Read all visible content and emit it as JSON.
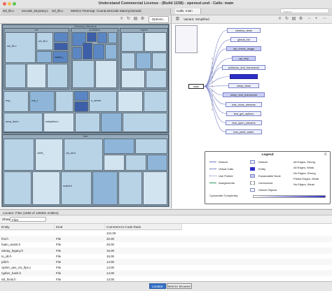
{
  "window": {
    "title": "Understand Commercial License - (Build 1158) - openssl.und - Calls: main"
  },
  "tabs": [
    {
      "label": "ssl_lib.c"
    },
    {
      "label": "encode_key2any.c"
    },
    {
      "label": "ssl_lib.c"
    },
    {
      "label": "Metrics Treemap: CountLineCode MaxCyclomatic"
    },
    {
      "label": "Calls: main"
    }
  ],
  "search": {
    "placeholder": "Search"
  },
  "treemap_panel": {
    "options_label": "Options...",
    "group_labels": {
      "top": "Directory Structure",
      "ssl": "ssl",
      "crypto": "crypto",
      "providers": "providers",
      "test": "test",
      "apps": "apps"
    },
    "block_labels": {
      "ssl_lib": "ssl_lib.c",
      "s3_lib": "s3_lib.c",
      "statem": "statem_",
      "sslapitest": "sslapitest.c",
      "acvptest": "acvp_test.c",
      "x509": "x509_",
      "cls_dir": "cls_dir.h",
      "evp": "evp_",
      "evpt": "evp_t",
      "ssl_sw": "s_server",
      "sct": "sctest.h"
    }
  },
  "calls_panel": {
    "variant_label": "Variant: Simplified",
    "main_node": "main",
    "edge_label": "1",
    "callees": [
      "cleanup_tests",
      "global_init",
      "opt_check_usage",
      "opt_help",
      "pulldown_test_framework",
      "",
      "setup_tests",
      "setup_test_framework",
      "test_close_streams",
      "test_get_options",
      "test_open_streams",
      "test_printf_stderr"
    ],
    "legend": {
      "title": "Legend",
      "col1": [
        "Default",
        "Virtual Calls",
        "Use Pointer",
        "Assignments"
      ],
      "col2": [
        "Default",
        "Entity",
        "Expandable Node",
        "Unresolved",
        "Global Objects"
      ],
      "col3": [
        "All Edges, Strong",
        "All Edges, Weak",
        "No Edges, Strong",
        "Partial Edges, Weak",
        "No Edges, Weak"
      ],
      "gradient_label": "Cyclomatic Complexity"
    }
  },
  "locator": {
    "header": "Locator: Files (1980 of 138381 entities)",
    "show_label": "Show:",
    "show_value": "Files",
    "columns": [
      "Entity",
      "Kind",
      "Comment to Code Ratio"
    ],
    "rows": [
      {
        "entity": "",
        "kind": "",
        "ratio": "101.00"
      },
      {
        "entity": "fmt.h",
        "kind": "File",
        "ratio": "32.00"
      },
      {
        "entity": "haan_assist.h",
        "kind": "File",
        "ratio": "26.00"
      },
      {
        "entity": "ssleay_legacy.h",
        "kind": "File",
        "ratio": "16.00"
      },
      {
        "entity": "to_dir.h",
        "kind": "File",
        "ratio": "15.00"
      },
      {
        "entity": "pdir.h",
        "kind": "File",
        "ratio": "14.00"
      },
      {
        "entity": "cipher_aes_cts_fips.c",
        "kind": "File",
        "ratio": "14.00"
      },
      {
        "entity": "rypher_hash.h",
        "kind": "File",
        "ratio": "14.00"
      },
      {
        "entity": "ssl_hints.h",
        "kind": "File",
        "ratio": "13.00"
      }
    ]
  },
  "bottom_tabs": [
    {
      "label": "Locator"
    },
    {
      "label": "Metrics Browser"
    }
  ],
  "colors": {
    "accent": "#3470c8",
    "node_border": "#7a83c9",
    "highlight_node": "#2e2ec9",
    "treemap_block": "#b8d2e6"
  }
}
